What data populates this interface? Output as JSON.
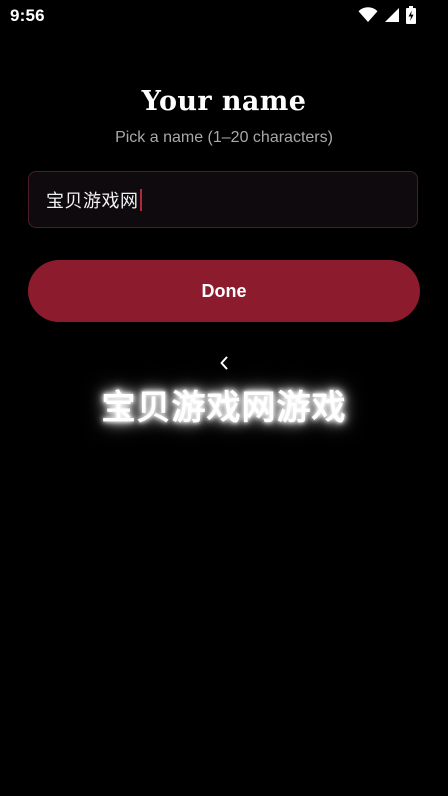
{
  "status_bar": {
    "time": "9:56",
    "icons": [
      "wifi-icon",
      "signal-icon",
      "battery-charging-icon"
    ]
  },
  "screen": {
    "title": "Your name",
    "subtitle": "Pick a name (1–20 characters)",
    "name_input": {
      "value": "宝贝游戏网"
    },
    "done_label": "Done",
    "back_glyph": "‹",
    "watermark": "宝贝游戏网游戏"
  },
  "colors": {
    "background": "#000000",
    "accent": "#8c1b2e",
    "input_border": "#4a1e28",
    "caret": "#b3263a",
    "subtitle_text": "#a9a9ad"
  }
}
